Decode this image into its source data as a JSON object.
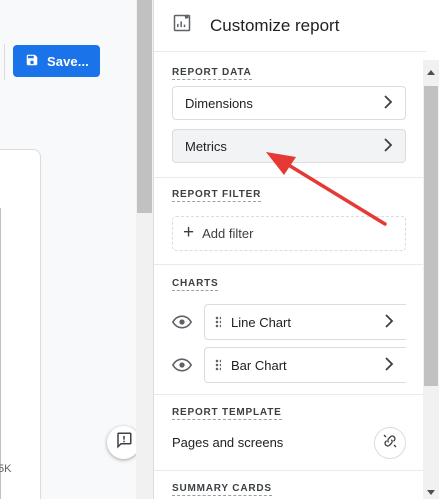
{
  "left": {
    "save_label": "Save...",
    "axis_tick": "5K"
  },
  "panel": {
    "title": "Customize report",
    "report_data": {
      "heading": "REPORT DATA",
      "items": [
        {
          "label": "Dimensions"
        },
        {
          "label": "Metrics"
        }
      ]
    },
    "report_filter": {
      "heading": "REPORT FILTER",
      "add_label": "Add filter"
    },
    "charts": {
      "heading": "CHARTS",
      "items": [
        {
          "label": "Line Chart"
        },
        {
          "label": "Bar Chart"
        }
      ]
    },
    "report_template": {
      "heading": "REPORT TEMPLATE",
      "value": "Pages and screens"
    },
    "summary_cards": {
      "heading": "SUMMARY CARDS"
    }
  },
  "colors": {
    "primary": "#1a73e8",
    "annotation_arrow": "#e53935"
  },
  "icons": [
    "save-icon",
    "report-customize-icon",
    "chevron-right-icon",
    "plus-icon",
    "eye-icon",
    "drag-handle-icon",
    "unlink-icon",
    "feedback-icon"
  ]
}
